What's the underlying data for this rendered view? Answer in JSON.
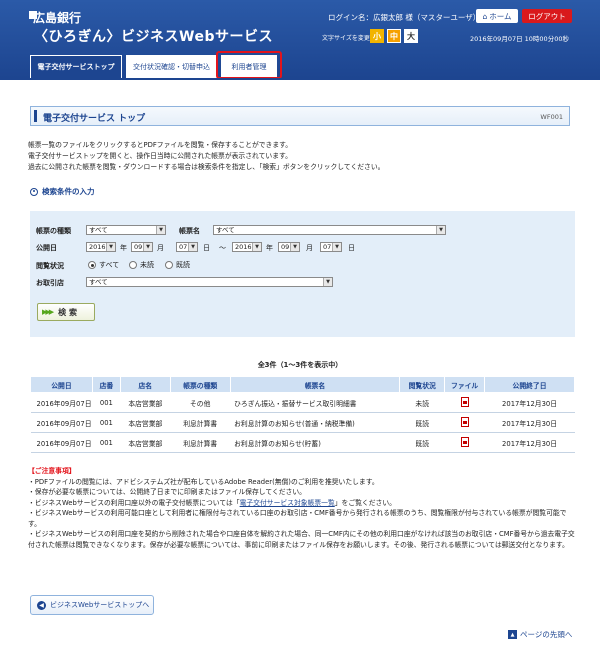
{
  "header": {
    "bank_name": "広島銀行",
    "service_name": "〈ひろぎん〉ビジネスWebサービス",
    "login_name": "ログイン名：広銀太郎 様（マスターユーザ）",
    "home_label": "ホーム",
    "logout_label": "ログアウト",
    "fontsize_label": "文字サイズを変更",
    "fontsize_small": "小",
    "fontsize_mid": "中",
    "fontsize_large": "大",
    "datetime": "2016年09月07日 10時00分00秒"
  },
  "tabs": [
    {
      "label": "電子交付サービストップ"
    },
    {
      "label": "交付状況確認・切替申込"
    },
    {
      "label": "利用者管理"
    }
  ],
  "page": {
    "title": "電子交付サービス トップ",
    "screen_id": "WF001",
    "desc1": "帳票一覧のファイルをクリックするとPDFファイルを閲覧・保存することができます。",
    "desc2": "電子交付サービストップを開くと、操作日当時に公開された帳票が表示されています。",
    "desc3": "過去に公開された帳票を閲覧・ダウンロードする場合は検索条件を指定し、「検索」ボタンをクリックしてください。"
  },
  "search": {
    "section_title": "検索条件の入力",
    "type_label": "帳票の種類",
    "type_value": "すべて",
    "name_label": "帳票名",
    "name_value": "すべて",
    "date_label": "公開日",
    "from_year": "2016",
    "from_month": "09",
    "from_day": "07",
    "to_year": "2016",
    "to_month": "09",
    "to_day": "07",
    "unit_year": "年",
    "unit_month": "月",
    "unit_day": "日",
    "tilde": "～",
    "status_label": "閲覧状況",
    "status_all": "すべて",
    "status_unread": "未読",
    "status_read": "既読",
    "branch_label": "お取引店",
    "branch_value": "すべて",
    "search_button": "検 索"
  },
  "results": {
    "count_text": "全3件（1～3件を表示中）",
    "headers": [
      "公開日",
      "店番",
      "店名",
      "帳票の種類",
      "帳票名",
      "閲覧状況",
      "ファイル",
      "公開終了日"
    ],
    "rows": [
      [
        "2016年09月07日",
        "001",
        "本店営業部",
        "その他",
        "ひろぎん振込・振替サービス取引明細書",
        "未読",
        "",
        "2017年12月30日"
      ],
      [
        "2016年09月07日",
        "001",
        "本店営業部",
        "利息計算書",
        "お利息計算のお知らせ(普通・納税準備)",
        "既読",
        "",
        "2017年12月30日"
      ],
      [
        "2016年09月07日",
        "001",
        "本店営業部",
        "利息計算書",
        "お利息計算のお知らせ(貯蓄)",
        "既読",
        "",
        "2017年12月30日"
      ]
    ]
  },
  "notes": {
    "head": "【ご注意事項】",
    "n1": "・PDFファイルの閲覧には、アドビシステムズ社が配布しているAdobe Reader(無償)のご利用を推奨いたします。",
    "n2": "・保存が必要な帳票については、公開終了日までに印刷またはファイル保存してください。",
    "n3a": "・ビジネスWebサービスの利用口座以外の電子交付帳票については「",
    "n3link": "電子交付サービス対象帳票一覧",
    "n3b": "」をご覧ください。",
    "n4": "・ビジネスWebサービスの利用可能口座として利用者に権限付与されている口座のお取引店・CMF番号から発行される帳票のうち、閲覧権限が付与されている帳票が閲覧可能です。",
    "n5": "・ビジネスWebサービスの利用口座を契約から削除された場合や口座自体を解約された場合、同一CMF内にその他の利用口座がなければ該当のお取引店・CMF番号から過去電子交付された帳票は閲覧できなくなります。保存が必要な帳票については、事前に印刷またはファイル保存をお願いします。その後、発行される帳票については郵送交付となります。"
  },
  "footer": {
    "back_label": "ビジネスWebサービストップへ",
    "pagetop_label": "ページの先頭へ"
  },
  "colors": {
    "brand": "#1d4590",
    "accent_red": "#e3141c",
    "panel": "#e3eef9"
  }
}
